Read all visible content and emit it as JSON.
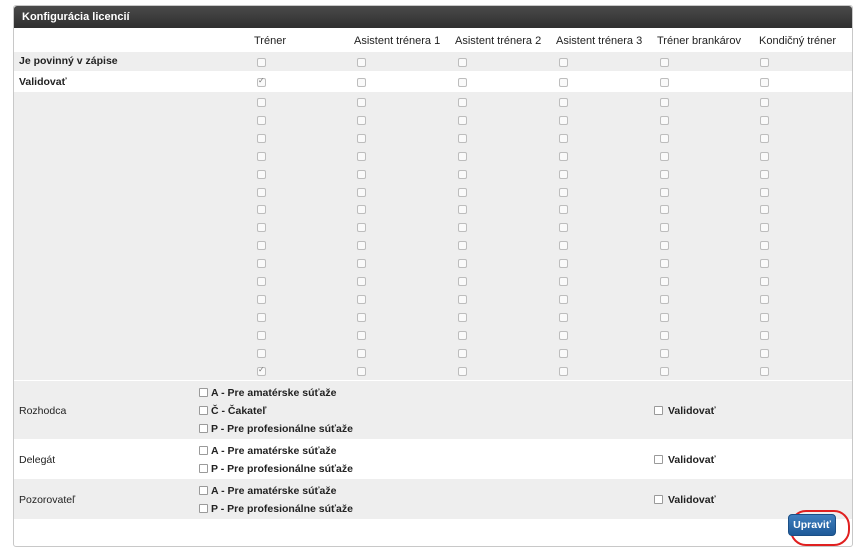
{
  "panel": {
    "title": "Konfigurácia licencií"
  },
  "columns": [
    "Tréner",
    "Asistent trénera 1",
    "Asistent trénera 2",
    "Asistent trénera 3",
    "Tréner brankárov",
    "Kondičný tréner"
  ],
  "rows": {
    "required_label": "Je povinný v zápise",
    "validate_label": "Validovať"
  },
  "sections": [
    {
      "label": "Rozhodca",
      "options": [
        "A - Pre amatérske súťaže",
        "Č - Čakateľ",
        "P - Pre profesionálne súťaže"
      ],
      "validate": "Validovať"
    },
    {
      "label": "Delegát",
      "options": [
        "A - Pre amatérske súťaže",
        "P - Pre profesionálne súťaže"
      ],
      "validate": "Validovať"
    },
    {
      "label": "Pozorovateľ",
      "options": [
        "A - Pre amatérske súťaže",
        "P - Pre profesionálne súťaže"
      ],
      "validate": "Validovať"
    }
  ],
  "actions": {
    "edit": "Upraviť"
  }
}
